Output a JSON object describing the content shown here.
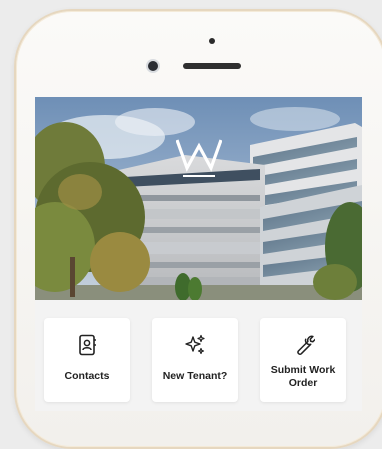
{
  "brand": {
    "logo_letter": "W"
  },
  "hero": {
    "image_description_icon": "office-building-photo"
  },
  "tiles": [
    {
      "label": "Contacts",
      "icon": "contacts-book-icon"
    },
    {
      "label": "New Tenant?",
      "icon": "sparkles-icon"
    },
    {
      "label": "Submit Work Order",
      "icon": "wrench-icon"
    }
  ],
  "colors": {
    "accent_text": "#222222",
    "tile_bg": "#ffffff",
    "phone_frame": "#e6d7bf"
  }
}
